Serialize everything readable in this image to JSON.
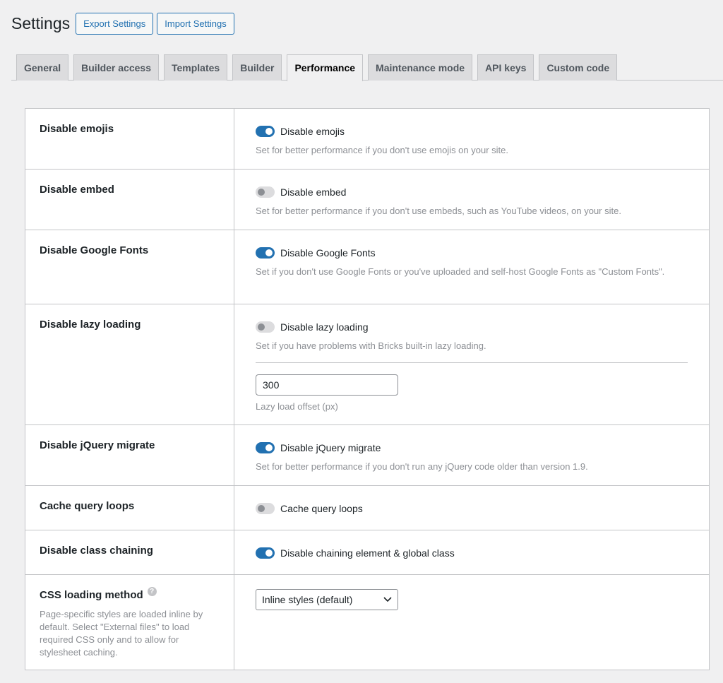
{
  "header": {
    "title": "Settings",
    "export_label": "Export Settings",
    "import_label": "Import Settings"
  },
  "tabs": [
    {
      "label": "General"
    },
    {
      "label": "Builder access"
    },
    {
      "label": "Templates"
    },
    {
      "label": "Builder"
    },
    {
      "label": "Performance",
      "active": true
    },
    {
      "label": "Maintenance mode"
    },
    {
      "label": "API keys"
    },
    {
      "label": "Custom code"
    }
  ],
  "rows": {
    "emojis": {
      "label": "Disable emojis",
      "toggle_label": "Disable emojis",
      "enabled": true,
      "description": "Set for better performance if you don't use emojis on your site."
    },
    "embed": {
      "label": "Disable embed",
      "toggle_label": "Disable embed",
      "enabled": false,
      "description": "Set for better performance if you don't use embeds, such as YouTube videos, on your site."
    },
    "google_fonts": {
      "label": "Disable Google Fonts",
      "toggle_label": "Disable Google Fonts",
      "enabled": true,
      "description": "Set if you don't use Google Fonts or you've uploaded and self-host Google Fonts as \"Custom Fonts\"."
    },
    "lazy": {
      "label": "Disable lazy loading",
      "toggle_label": "Disable lazy loading",
      "enabled": false,
      "description": "Set if you have problems with Bricks built-in lazy loading.",
      "offset_value": "300",
      "offset_label": "Lazy load offset (px)"
    },
    "jquery": {
      "label": "Disable jQuery migrate",
      "toggle_label": "Disable jQuery migrate",
      "enabled": true,
      "description": "Set for better performance if you don't run any jQuery code older than version 1.9."
    },
    "cache": {
      "label": "Cache query loops",
      "toggle_label": "Cache query loops",
      "enabled": false
    },
    "chaining": {
      "label": "Disable class chaining",
      "toggle_label": "Disable chaining element & global class",
      "enabled": true
    },
    "css": {
      "label": "CSS loading method",
      "help_icon": "?",
      "description": "Page-specific styles are loaded inline by default. Select \"External files\" to load required CSS only and to allow for stylesheet caching.",
      "selected": "Inline styles (default)"
    }
  },
  "colors": {
    "accent": "#2271b1",
    "background": "#f0f0f1",
    "muted_text": "#8c8f94"
  }
}
